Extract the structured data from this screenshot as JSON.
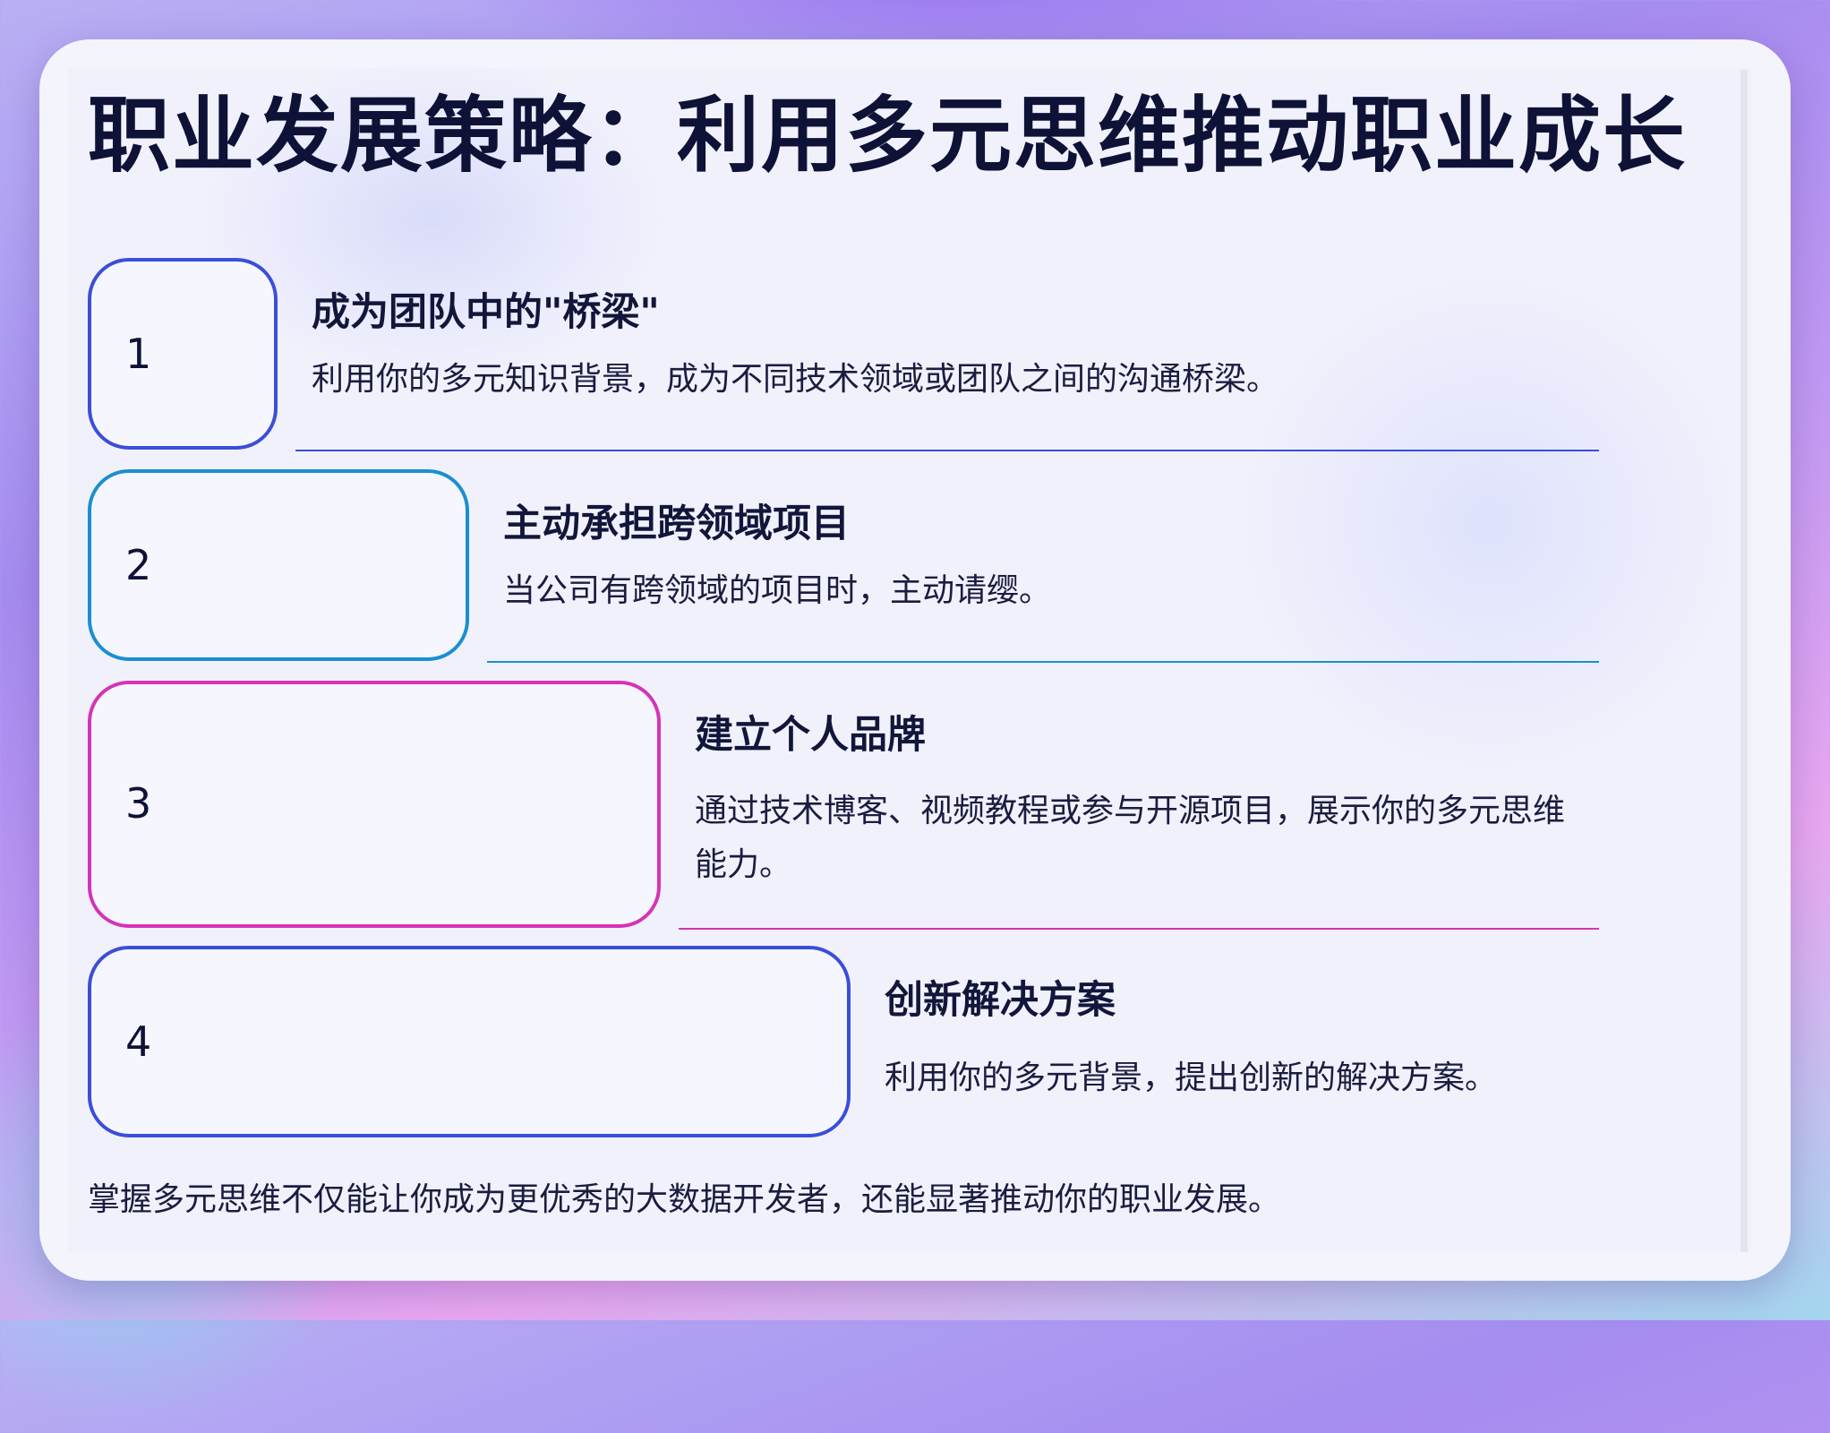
{
  "title": "职业发展策略：利用多元思维推动职业成长",
  "steps": [
    {
      "number": "1",
      "title": "成为团队中的\"桥梁\"",
      "description": "利用你的多元知识背景，成为不同技术领域或团队之间的沟通桥梁。",
      "color": "#3b4ed8"
    },
    {
      "number": "2",
      "title": "主动承担跨领域项目",
      "description": "当公司有跨领域的项目时，主动请缨。",
      "color": "#1a8fd0"
    },
    {
      "number": "3",
      "title": "建立个人品牌",
      "description": "通过技术博客、视频教程或参与开源项目，展示你的多元思维能力。",
      "color": "#d434b6"
    },
    {
      "number": "4",
      "title": "创新解决方案",
      "description": "利用你的多元背景，提出创新的解决方案。",
      "color": "#3b4ed8"
    }
  ],
  "footer": "掌握多元思维不仅能让你成为更优秀的大数据开发者，还能显著推动你的职业发展。"
}
